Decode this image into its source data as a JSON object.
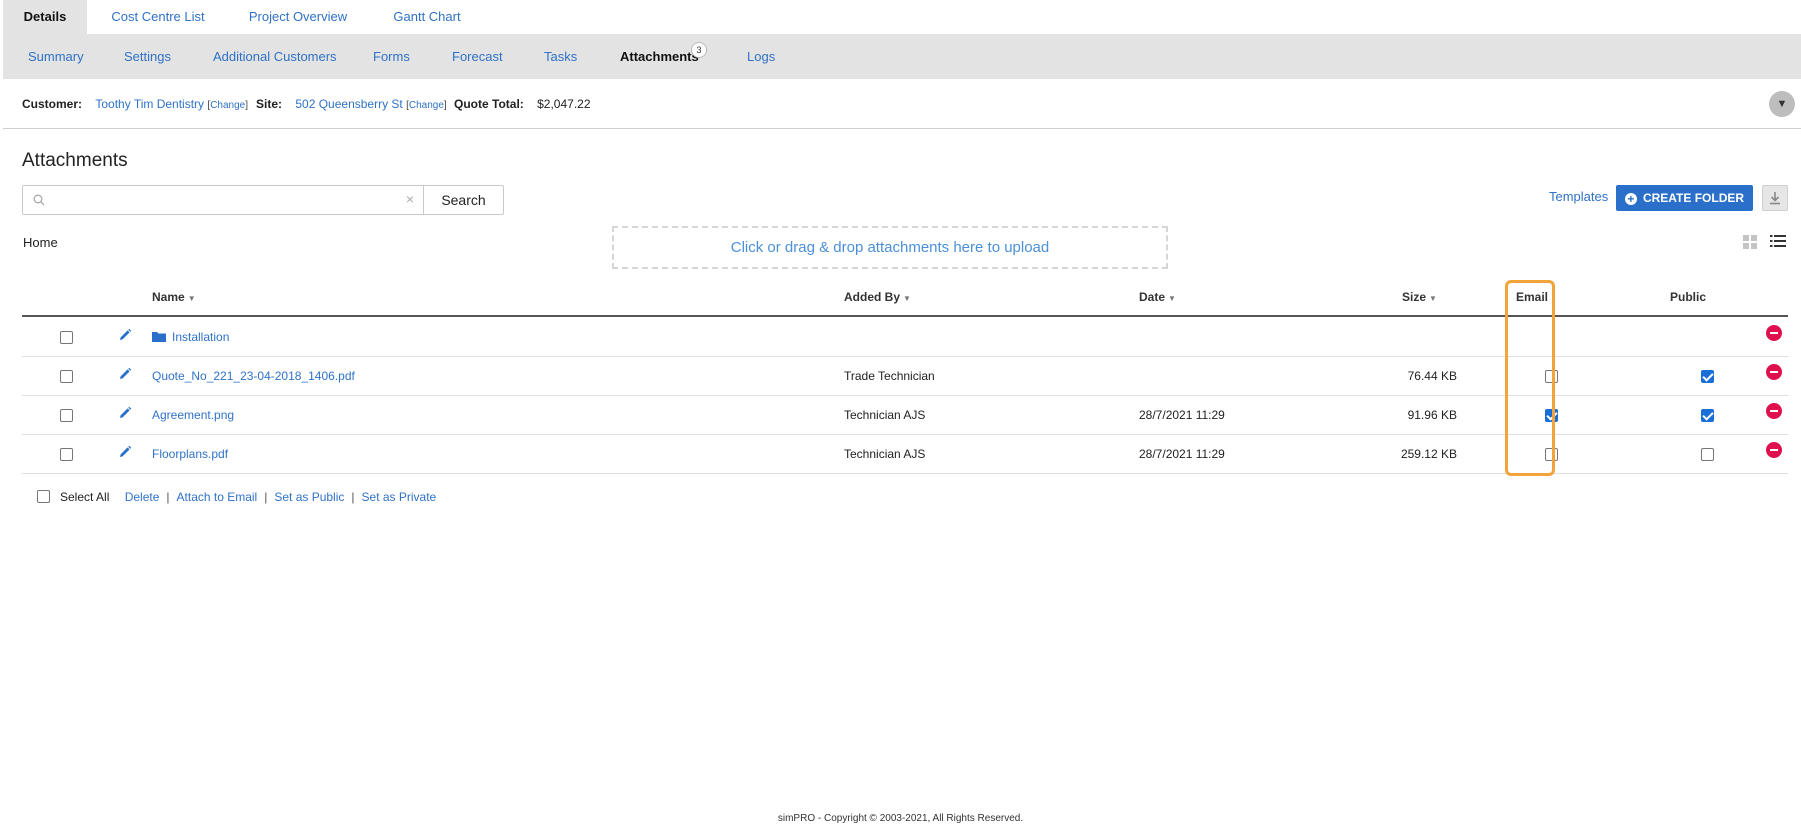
{
  "top_tabs": [
    {
      "label": "Details",
      "active": true
    },
    {
      "label": "Cost Centre List",
      "active": false
    },
    {
      "label": "Project Overview",
      "active": false
    },
    {
      "label": "Gantt Chart",
      "active": false
    }
  ],
  "sub_tabs": [
    {
      "label": "Summary",
      "active": false
    },
    {
      "label": "Settings",
      "active": false
    },
    {
      "label": "Additional Customers",
      "active": false
    },
    {
      "label": "Forms",
      "active": false
    },
    {
      "label": "Forecast",
      "active": false
    },
    {
      "label": "Tasks",
      "active": false
    },
    {
      "label": "Attachments",
      "active": true,
      "badge": "3"
    },
    {
      "label": "Logs",
      "active": false
    }
  ],
  "info_bar": {
    "customer_label": "Customer:",
    "customer_value": "Toothy Tim Dentistry",
    "site_label": "Site:",
    "site_value": "502 Queensberry St",
    "change_label": "Change",
    "quote_total_label": "Quote Total:",
    "quote_total_value": "$2,047.22",
    "collapse_icon": "chevron-down-icon"
  },
  "page_title": "Attachments",
  "search": {
    "value": "",
    "placeholder": "",
    "clear_glyph": "×",
    "button_label": "Search"
  },
  "actions": {
    "templates_label": "Templates",
    "create_folder_label": "CREATE FOLDER"
  },
  "breadcrumb": "Home",
  "dropzone_label": "Click or drag & drop attachments here to upload",
  "table": {
    "columns": {
      "name": "Name",
      "added_by": "Added By",
      "date": "Date",
      "size": "Size",
      "email": "Email",
      "public": "Public"
    },
    "rows": [
      {
        "type": "folder",
        "name": "Installation",
        "added_by": "",
        "date": "",
        "size": "",
        "email": null,
        "public": null
      },
      {
        "type": "file",
        "name": "Quote_No_221_23-04-2018_1406.pdf",
        "added_by": "Trade Technician",
        "date": "",
        "size": "76.44 KB",
        "email": false,
        "public": true
      },
      {
        "type": "file",
        "name": "Agreement.png",
        "added_by": "Technician AJS",
        "date": "28/7/2021 11:29",
        "size": "91.96 KB",
        "email": true,
        "public": true
      },
      {
        "type": "file",
        "name": "Floorplans.pdf",
        "added_by": "Technician AJS",
        "date": "28/7/2021 11:29",
        "size": "259.12 KB",
        "email": false,
        "public": false
      }
    ]
  },
  "bulk_actions": {
    "select_all": "Select All",
    "delete": "Delete",
    "attach_to_email": "Attach to Email",
    "set_public": "Set as Public",
    "set_private": "Set as Private"
  },
  "footer": "simPRO - Copyright © 2003-2021, All Rights Reserved.",
  "colors": {
    "accent": "#2a6fca",
    "link": "#2f72c8",
    "highlight": "#f2a43a",
    "danger": "#e0104f",
    "tab_bg": "#e3e3e3"
  }
}
